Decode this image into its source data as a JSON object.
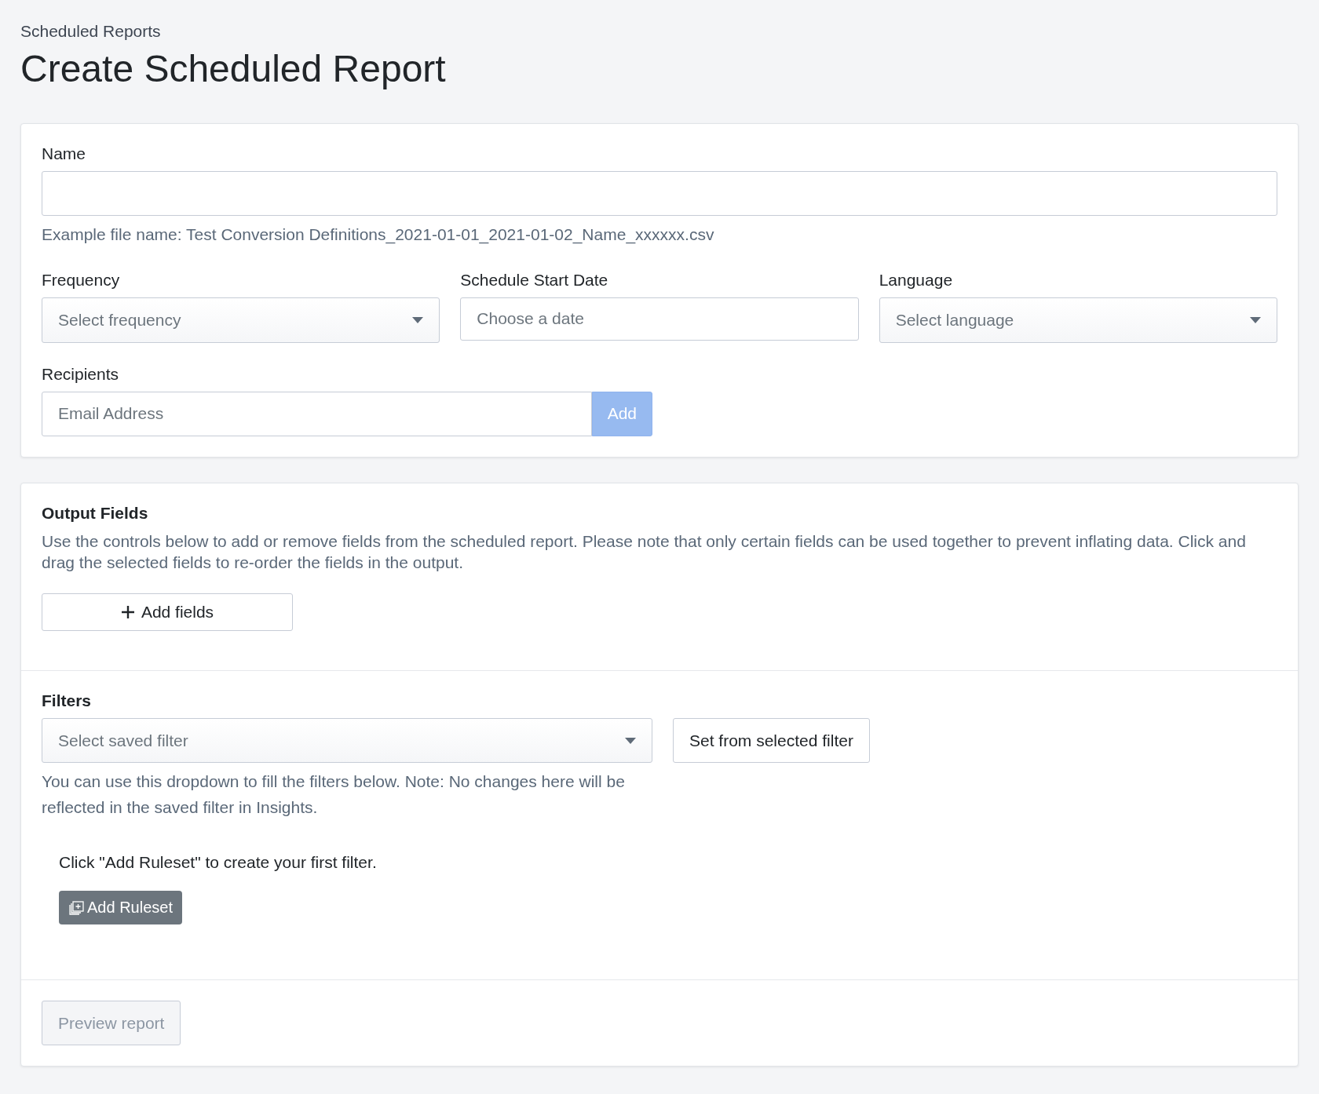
{
  "breadcrumb": "Scheduled Reports",
  "title": "Create Scheduled Report",
  "name_field": {
    "label": "Name",
    "hint": "Example file name: Test Conversion Definitions_2021-01-01_2021-01-02_Name_xxxxxx.csv"
  },
  "settings": [
    {
      "kind": "select",
      "label": "Frequency",
      "placeholder": "Select frequency"
    },
    {
      "kind": "date",
      "label": "Schedule Start Date",
      "placeholder": "Choose a date"
    },
    {
      "kind": "select",
      "label": "Language",
      "placeholder": "Select language"
    }
  ],
  "recipients": {
    "label": "Recipients",
    "placeholder": "Email Address",
    "button": {
      "label": "Add",
      "disabled": true
    }
  },
  "output_fields": {
    "title": "Output Fields",
    "description": "Use the controls below to add or remove fields from the scheduled report. Please note that only certain fields can be used together to prevent inflating data. Click and drag the selected fields to re-order the fields in the output.",
    "button": "Add fields"
  },
  "filters": {
    "title": "Filters",
    "select_placeholder": "Select saved filter",
    "set_button": "Set from selected filter",
    "hint": "You can use this dropdown to fill the filters below. Note: No changes here will be reflected in the saved filter in Insights.",
    "empty_text": "Click \"Add Ruleset\" to create your first filter.",
    "ruleset_button": "Add Ruleset"
  },
  "preview_button": {
    "label": "Preview report",
    "disabled": true
  }
}
